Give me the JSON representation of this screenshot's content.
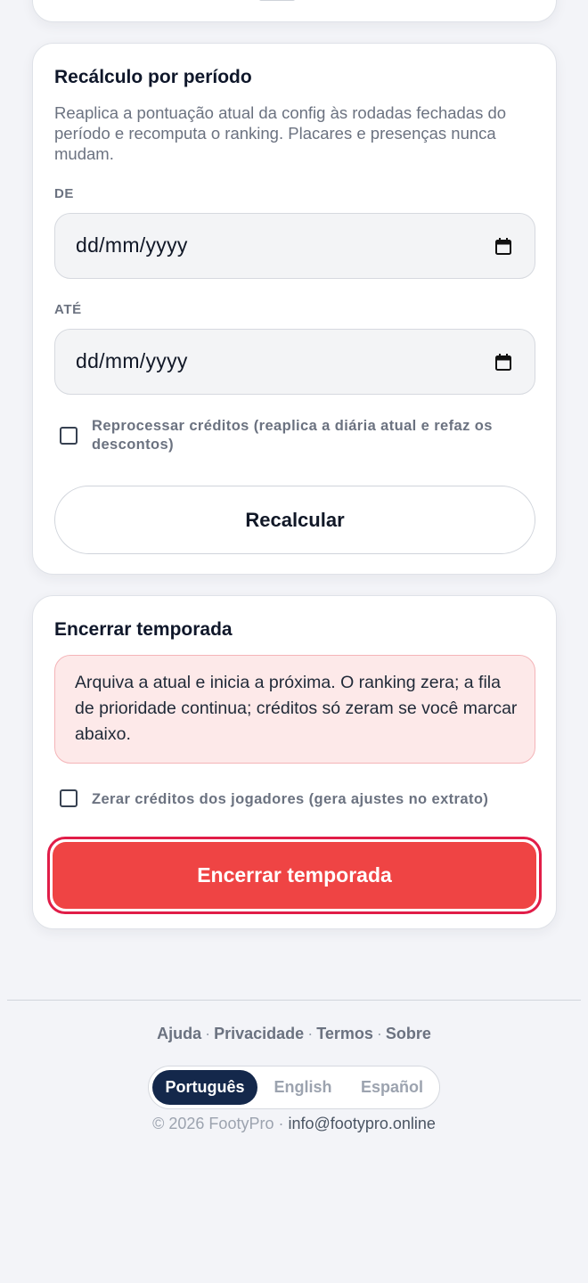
{
  "recalc": {
    "title": "Recálculo por período",
    "description": "Reaplica a pontuação atual da config às rodadas fechadas do período e recomputa o ranking. Placares e presenças nunca mudam.",
    "from_label": "DE",
    "from_value": "dd/mm/yyyy",
    "to_label": "ATÉ",
    "to_value": "dd/mm/yyyy",
    "reprocess_label": "Reprocessar créditos (reaplica a diária atual e refaz os descontos)",
    "button_label": "Recalcular"
  },
  "season": {
    "title": "Encerrar temporada",
    "warning": "Arquiva a atual e inicia a próxima. O ranking zera; a fila de prioridade continua; créditos só zeram se você marcar abaixo.",
    "reset_credits_label": "Zerar créditos dos jogadores (gera ajustes no extrato)",
    "button_label": "Encerrar temporada"
  },
  "footer": {
    "links": [
      "Ajuda",
      "Privacidade",
      "Termos",
      "Sobre"
    ],
    "separator": "·",
    "languages": [
      "Português",
      "English",
      "Español"
    ],
    "selected_language": "Português",
    "copyright": "© 2026 FootyPro",
    "email": "info@footypro.online"
  },
  "colors": {
    "danger": "#ef4444",
    "danger_border": "#e11d48",
    "lang_active": "#14284b",
    "warning_bg": "#fde9e9"
  }
}
